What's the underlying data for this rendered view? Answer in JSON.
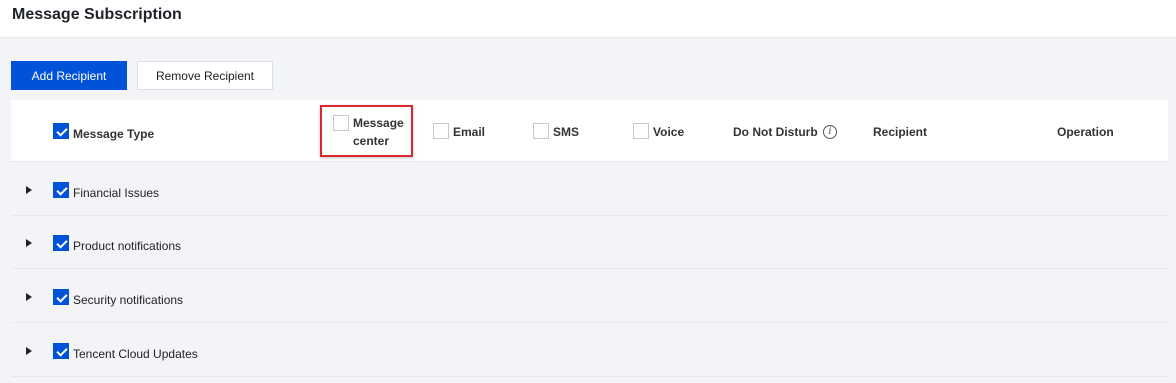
{
  "header": {
    "title": "Message Subscription"
  },
  "toolbar": {
    "add_label": "Add Recipient",
    "remove_label": "Remove Recipient"
  },
  "table": {
    "columns": {
      "message_type": "Message Type",
      "message_center_line1": "Message",
      "message_center_line2": "center",
      "email": "Email",
      "sms": "SMS",
      "voice": "Voice",
      "do_not_disturb": "Do Not Disturb",
      "recipient": "Recipient",
      "operation": "Operation"
    },
    "rows": [
      {
        "label": "Financial Issues"
      },
      {
        "label": "Product notifications"
      },
      {
        "label": "Security notifications"
      },
      {
        "label": "Tencent Cloud Updates"
      }
    ]
  },
  "icons": {
    "info": "info-circle-icon",
    "expand": "caret-right-icon",
    "checkbox": "checkbox-icon"
  },
  "colors": {
    "primary": "#0052d9",
    "highlight": "#d9272e",
    "background": "#f3f4f7"
  }
}
